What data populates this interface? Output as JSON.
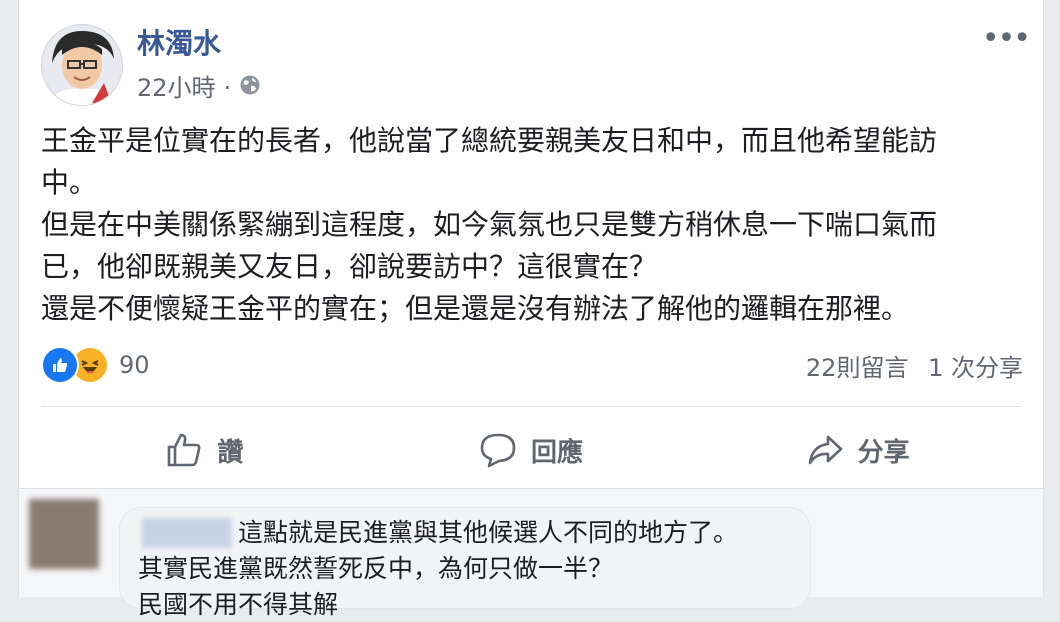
{
  "post": {
    "author": "林濁水",
    "time": "22小時",
    "separator": "·",
    "privacy_icon": "globe-icon",
    "more_icon": "more-options-icon",
    "body_lines": [
      "王金平是位實在的長者，他說當了總統要親美友日和中，而且他希望能訪",
      "中。",
      "但是在中美關係緊繃到這程度，如今氣氛也只是雙方稍休息一下喘口氣而",
      "已，他卻既親美又友日，卻說要訪中？這很實在？",
      "還是不便懷疑王金平的實在；但是還是沒有辦法了解他的邏輯在那裡。"
    ]
  },
  "reactions": {
    "icons": [
      "like-icon",
      "haha-icon"
    ],
    "count": "90",
    "comments": "22則留言",
    "shares": "1 次分享"
  },
  "actions": {
    "like": "讚",
    "comment": "回應",
    "share": "分享"
  },
  "comment": {
    "line1": "這點就是民進黨與其他候選人不同的地方了。",
    "line2": "其實民進黨既然誓死反中，為何只做一半？",
    "line3": "民國不用不得其解"
  },
  "colors": {
    "link_blue": "#385898",
    "like_blue": "#1877f2",
    "haha_yellow": "#f7b125",
    "text": "#1c1e21",
    "secondary": "#606770"
  }
}
